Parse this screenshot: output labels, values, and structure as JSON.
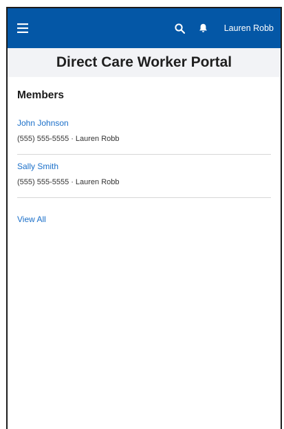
{
  "header": {
    "user_name": "Lauren Robb",
    "icons": [
      "hamburger-menu-icon",
      "search-icon",
      "bell-icon"
    ],
    "background": "#0457a6"
  },
  "page": {
    "title": "Direct Care Worker Portal"
  },
  "members": {
    "section_title": "Members",
    "items": [
      {
        "name": "John Johnson",
        "phone": "(555) 555-5555",
        "worker": "Lauren Robb"
      },
      {
        "name": "Sally Smith",
        "phone": "(555) 555-5555",
        "worker": "Lauren Robb"
      }
    ],
    "separator": "·",
    "view_all_label": "View All"
  },
  "colors": {
    "link": "#1a6fc9",
    "title_bar_bg": "#f2f3f6"
  }
}
